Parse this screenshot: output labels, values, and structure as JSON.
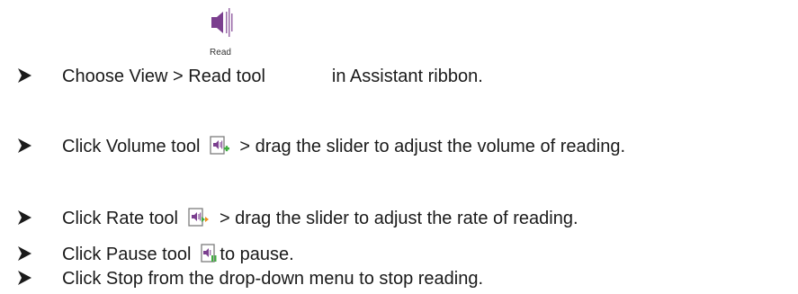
{
  "items": [
    {
      "before": "Choose View > Read tool",
      "icon": "read-speaker-icon",
      "icon_label": "Read",
      "after": "in Assistant ribbon."
    },
    {
      "before": "Click Volume tool",
      "icon": "volume-document-icon",
      "after": "> drag the slider to adjust the volume of reading."
    },
    {
      "before": "Click Rate tool",
      "icon": "rate-document-icon",
      "after": "> drag the slider to adjust the rate of reading."
    },
    {
      "before": "Click Pause tool",
      "icon": "pause-document-icon",
      "after": "to pause."
    },
    {
      "before": "Click Stop from the drop-down menu to stop reading.",
      "icon": "",
      "after": ""
    }
  ],
  "colors": {
    "accent_purple": "#7b3f8f",
    "accent_green": "#3fae3f",
    "accent_orange": "#ef8a1a"
  }
}
